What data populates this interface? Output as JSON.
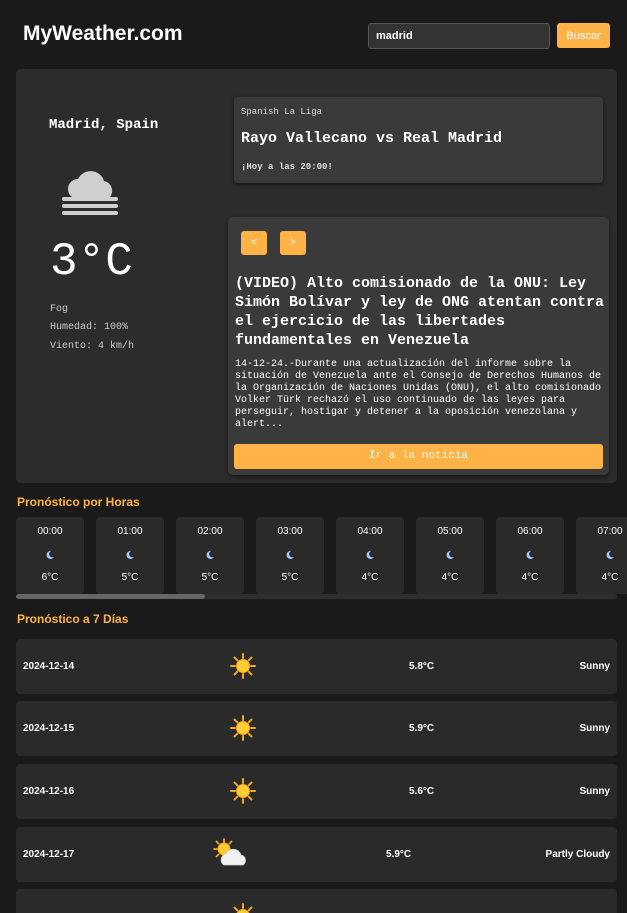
{
  "header": {
    "logo": "MyWeather.com",
    "search_value": "madrid",
    "search_button": "Buscar"
  },
  "current": {
    "city": "Madrid, Spain",
    "icon": "fog-icon",
    "temperature": "3°C",
    "condition": "Fog",
    "humidity": "Humedad: 100%",
    "wind": "Viento: 4 km/h"
  },
  "match": {
    "league": "Spanish La Liga",
    "teams": "Rayo Vallecano vs Real Madrid",
    "time": "¡Hoy a las 20:00!"
  },
  "news": {
    "prev": "<",
    "next": ">",
    "title": "(VIDEO) Alto comisionado de la ONU: Ley Simón Bolívar y ley de ONG atentan contra el ejercicio de las libertades fundamentales en Venezuela",
    "body": "14-12-24.-Durante una actualización del informe sobre la situación de Venezuela ante el Consejo de Derechos Humanos de la Organización de Naciones Unidas (ONU), el alto comisionado Volker Türk rechazó el uso continuado de las leyes para perseguir, hostigar y detener a la oposición venezolana y alert...",
    "link": "Ir a la noticia"
  },
  "hourly": {
    "title": "Pronóstico por Horas",
    "items": [
      {
        "time": "00:00",
        "icon": "moon-icon",
        "temp": "6°C"
      },
      {
        "time": "01:00",
        "icon": "moon-icon",
        "temp": "5°C"
      },
      {
        "time": "02:00",
        "icon": "moon-icon",
        "temp": "5°C"
      },
      {
        "time": "03:00",
        "icon": "moon-icon",
        "temp": "5°C"
      },
      {
        "time": "04:00",
        "icon": "moon-icon",
        "temp": "4°C"
      },
      {
        "time": "05:00",
        "icon": "moon-icon",
        "temp": "4°C"
      },
      {
        "time": "06:00",
        "icon": "moon-icon",
        "temp": "4°C"
      },
      {
        "time": "07:00",
        "icon": "moon-icon",
        "temp": "4°C"
      }
    ]
  },
  "daily": {
    "title": "Pronóstico a 7 Días",
    "items": [
      {
        "date": "2024-12-14",
        "icon": "sun-icon",
        "temp": "5.8°C",
        "condition": "Sunny"
      },
      {
        "date": "2024-12-15",
        "icon": "sun-icon",
        "temp": "5.9°C",
        "condition": "Sunny"
      },
      {
        "date": "2024-12-16",
        "icon": "sun-icon",
        "temp": "5.6°C",
        "condition": "Sunny"
      },
      {
        "date": "2024-12-17",
        "icon": "partly-cloudy-icon",
        "temp": "5.9°C",
        "condition": "Partly Cloudy"
      },
      {
        "date": "",
        "icon": "sun-icon",
        "temp": "",
        "condition": ""
      }
    ]
  },
  "colors": {
    "accent": "#ffb347",
    "background": "#1a1a1a",
    "card": "#2c2c2c"
  }
}
